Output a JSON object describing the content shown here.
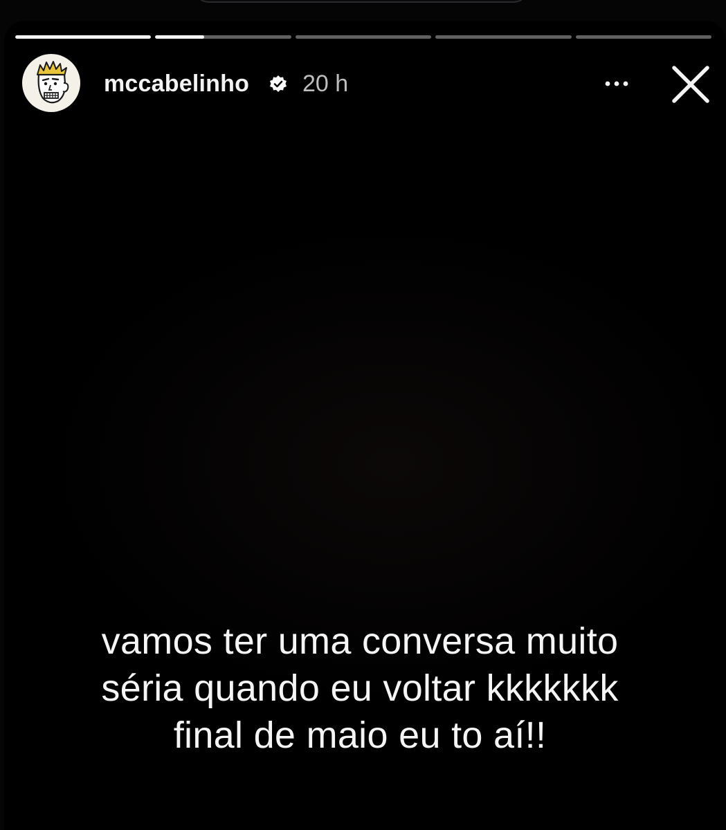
{
  "story": {
    "progress": [
      {
        "fill": 1.0
      },
      {
        "fill": 0.36
      },
      {
        "fill": 0
      },
      {
        "fill": 0
      },
      {
        "fill": 0
      }
    ],
    "author": {
      "username": "mccabelinho",
      "verified": true,
      "verified_icon": "verified-badge-icon",
      "avatar_icon": "cartoon-avatar"
    },
    "posted_ago": "20 h",
    "more_icon": "more-options-icon",
    "close_icon": "close-icon",
    "caption_lines": [
      "vamos ter uma conversa muito",
      "séria quando eu voltar kkkkkkk",
      "final de maio eu to aí!!"
    ],
    "colors": {
      "background": "#050506",
      "text": "#f5f5f5",
      "progress_track": "rgba(255,255,255,0.38)",
      "progress_fill": "#f2f2f2"
    }
  }
}
